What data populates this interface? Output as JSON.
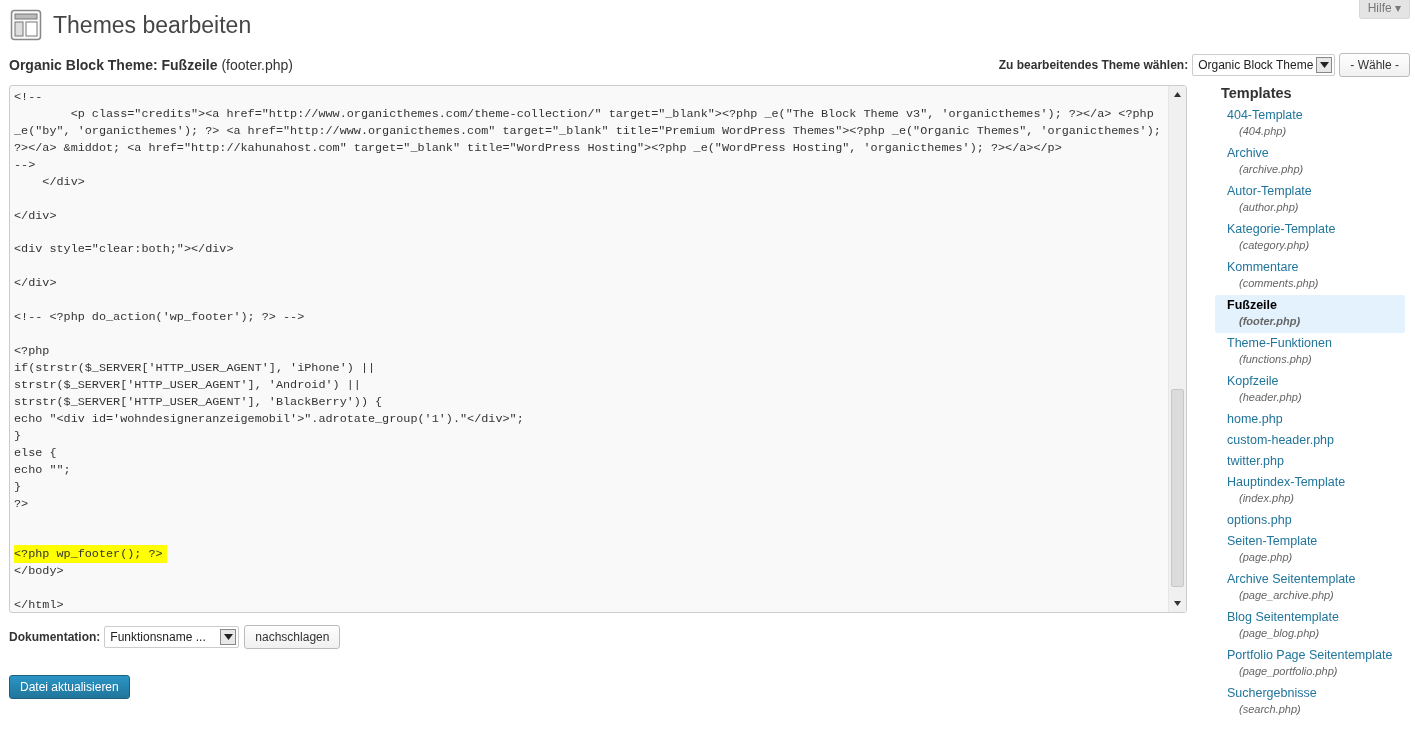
{
  "page": {
    "title": "Themes bearbeiten",
    "help_button": "Hilfe ▾"
  },
  "file_heading": {
    "theme": "Organic Block Theme: Fußzeile",
    "file": "(footer.php)"
  },
  "theme_picker": {
    "label": "Zu bearbeitendes Theme wählen:",
    "value": "Organic Block Theme",
    "button": "- Wähle -"
  },
  "editor": {
    "blocks": [
      {
        "highlighted": false,
        "text": "<!--\n        <p class=\"credits\"><a href=\"http://www.organicthemes.com/theme-collection/\" target=\"_blank\"><?php _e(\"The Block Theme v3\", 'organicthemes'); ?></a> <?php\n_e(\"by\", 'organicthemes'); ?> <a href=\"http://www.organicthemes.com\" target=\"_blank\" title=\"Premium WordPress Themes\"><?php _e(\"Organic Themes\", 'organicthemes');\n?></a> &middot; <a href=\"http://kahunahost.com\" target=\"_blank\" title=\"WordPress Hosting\"><?php _e(\"WordPress Hosting\", 'organicthemes'); ?></a></p>\n-->\n    </div>\n\n</div>\n\n<div style=\"clear:both;\"></div>\n\n</div>\n\n<!-- <?php do_action('wp_footer'); ?> -->\n\n<?php\nif(strstr($_SERVER['HTTP_USER_AGENT'], 'iPhone') ||\nstrstr($_SERVER['HTTP_USER_AGENT'], 'Android') ||\nstrstr($_SERVER['HTTP_USER_AGENT'], 'BlackBerry')) {\necho \"<div id='wohndesigneranzeigemobil'>\".adrotate_group('1').\"</div>\";\n}\nelse {\necho \"\";\n}\n?>\n\n"
      },
      {
        "highlighted": true,
        "text": "<?php wp_footer(); ?>"
      },
      {
        "highlighted": false,
        "text": "</body>\n\n</html>"
      }
    ]
  },
  "documentation": {
    "label": "Dokumentation:",
    "select": "Funktionsname ...",
    "button": "nachschlagen"
  },
  "submit_button": "Datei aktualisieren",
  "sidebar": {
    "title": "Templates",
    "items": [
      {
        "name": "404-Template",
        "file": "(404.php)",
        "selected": false
      },
      {
        "name": "Archive",
        "file": "(archive.php)",
        "selected": false
      },
      {
        "name": "Autor-Template",
        "file": "(author.php)",
        "selected": false
      },
      {
        "name": "Kategorie-Template",
        "file": "(category.php)",
        "selected": false
      },
      {
        "name": "Kommentare",
        "file": "(comments.php)",
        "selected": false
      },
      {
        "name": "Fußzeile",
        "file": "(footer.php)",
        "selected": true
      },
      {
        "name": "Theme-Funktionen",
        "file": "(functions.php)",
        "selected": false
      },
      {
        "name": "Kopfzeile",
        "file": "(header.php)",
        "selected": false
      },
      {
        "name": "home.php",
        "selected": false
      },
      {
        "name": "custom-header.php",
        "selected": false
      },
      {
        "name": "twitter.php",
        "selected": false
      },
      {
        "name": "Hauptindex-Template",
        "file": "(index.php)",
        "selected": false
      },
      {
        "name": "options.php",
        "selected": false
      },
      {
        "name": "Seiten-Template",
        "file": "(page.php)",
        "selected": false
      },
      {
        "name": "Archive Seitentemplate",
        "file": "(page_archive.php)",
        "selected": false
      },
      {
        "name": "Blog Seitentemplate",
        "file": "(page_blog.php)",
        "selected": false
      },
      {
        "name": "Portfolio Page Seitentemplate",
        "file": "(page_portfolio.php)",
        "selected": false
      },
      {
        "name": "Suchergebnisse",
        "file": "(search.php)",
        "selected": false
      }
    ]
  }
}
